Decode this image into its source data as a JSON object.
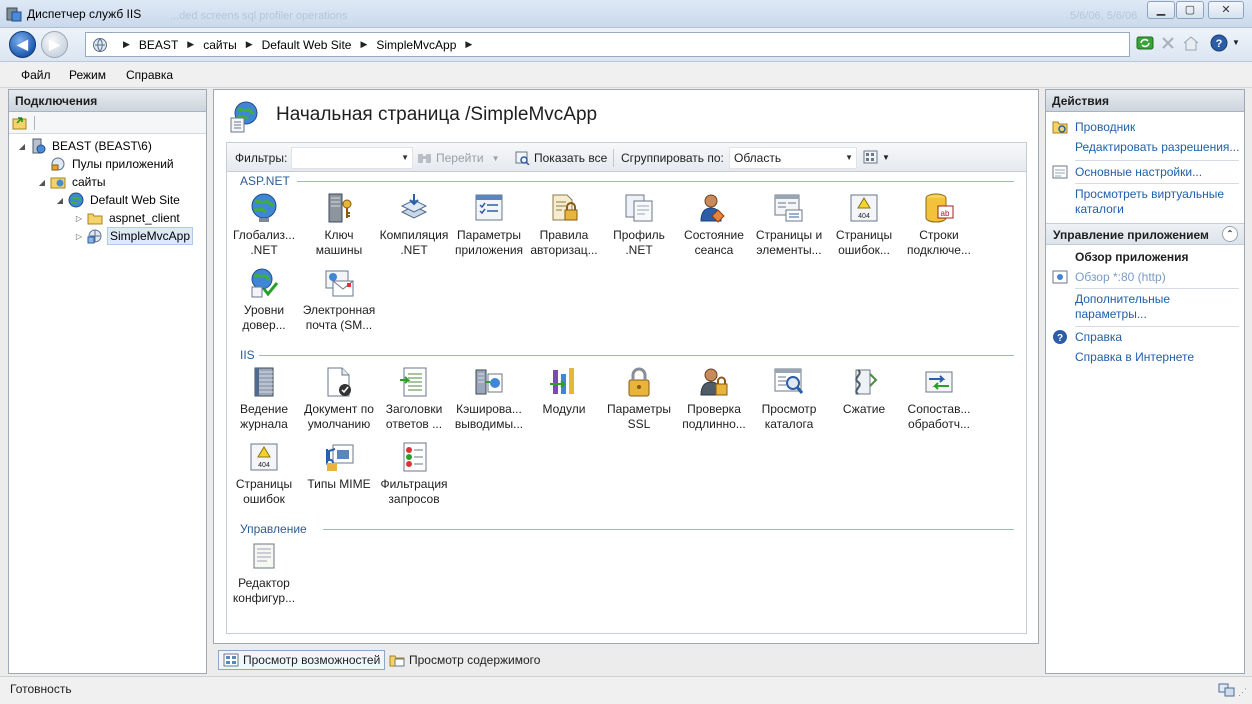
{
  "window": {
    "title": "Диспетчер служб IIS",
    "ghost_title": "...ded screens sql profiler operations",
    "ghost_right": "5/6/06, 5/6/06"
  },
  "address": {
    "crumbs": [
      "BEAST",
      "сайты",
      "Default Web Site",
      "SimpleMvcApp"
    ]
  },
  "menu": [
    "Файл",
    "Режим",
    "Справка"
  ],
  "connections": {
    "header": "Подключения",
    "tree": [
      {
        "label": "BEAST (BEAST\\6)",
        "icon": "server-icon",
        "twisty": "◢"
      },
      {
        "label": "Пулы приложений",
        "icon": "app-pool-icon",
        "twisty": ""
      },
      {
        "label": "сайты",
        "icon": "sites-folder-icon",
        "twisty": "◢"
      },
      {
        "label": "Default Web Site",
        "icon": "globe-icon",
        "twisty": "◢"
      },
      {
        "label": "aspnet_client",
        "icon": "folder-icon",
        "twisty": "▷"
      },
      {
        "label": "SimpleMvcApp",
        "icon": "web-app-icon",
        "twisty": "▷"
      }
    ]
  },
  "main": {
    "title": "Начальная страница /SimpleMvcApp",
    "filter_label": "Фильтры:",
    "go_label": "Перейти",
    "show_all_label": "Показать все",
    "group_by_label": "Сгруппировать по:",
    "group_by_value": "Область",
    "groups": [
      {
        "name": "ASP.NET",
        "items": [
          {
            "l1": "Глобализ...",
            "l2": ".NET",
            "icon": "globalization-icon"
          },
          {
            "l1": "Ключ",
            "l2": "машины",
            "icon": "machine-key-icon"
          },
          {
            "l1": "Компиляция",
            "l2": ".NET",
            "icon": "compilation-icon"
          },
          {
            "l1": "Параметры",
            "l2": "приложения",
            "icon": "app-settings-icon"
          },
          {
            "l1": "Правила",
            "l2": "авторизац...",
            "icon": "authorization-rules-icon"
          },
          {
            "l1": "Профиль",
            "l2": ".NET",
            "icon": "profile-icon"
          },
          {
            "l1": "Состояние",
            "l2": "сеанса",
            "icon": "session-state-icon"
          },
          {
            "l1": "Страницы и",
            "l2": "элементы...",
            "icon": "pages-controls-icon"
          },
          {
            "l1": "Страницы",
            "l2": "ошибок...",
            "icon": "error-pages-icon"
          },
          {
            "l1": "Строки",
            "l2": "подключе...",
            "icon": "connection-strings-icon"
          },
          {
            "l1": "Уровни",
            "l2": "довер...",
            "icon": "trust-levels-icon"
          },
          {
            "l1": "Электронная",
            "l2": "почта (SM...",
            "icon": "smtp-email-icon"
          }
        ]
      },
      {
        "name": "IIS",
        "items": [
          {
            "l1": "Ведение",
            "l2": "журнала",
            "icon": "logging-icon"
          },
          {
            "l1": "Документ по",
            "l2": "умолчанию",
            "icon": "default-document-icon"
          },
          {
            "l1": "Заголовки",
            "l2": "ответов ...",
            "icon": "response-headers-icon"
          },
          {
            "l1": "Кэширова...",
            "l2": "выводимы...",
            "icon": "output-caching-icon"
          },
          {
            "l1": "Модули",
            "l2": "",
            "icon": "modules-icon"
          },
          {
            "l1": "Параметры",
            "l2": "SSL",
            "icon": "ssl-lock-icon"
          },
          {
            "l1": "Проверка",
            "l2": "подлинно...",
            "icon": "authentication-icon"
          },
          {
            "l1": "Просмотр",
            "l2": "каталога",
            "icon": "directory-browsing-icon"
          },
          {
            "l1": "Сжатие",
            "l2": "",
            "icon": "compression-icon"
          },
          {
            "l1": "Сопостав...",
            "l2": "обработч...",
            "icon": "handler-mappings-icon"
          },
          {
            "l1": "Страницы",
            "l2": "ошибок",
            "icon": "error-pages-icon"
          },
          {
            "l1": "Типы MIME",
            "l2": "",
            "icon": "mime-types-icon"
          },
          {
            "l1": "Фильтрация",
            "l2": "запросов",
            "icon": "request-filtering-icon"
          }
        ]
      },
      {
        "name": "Управление",
        "items": [
          {
            "l1": "Редактор",
            "l2": "конфигур...",
            "icon": "config-editor-icon"
          }
        ]
      }
    ]
  },
  "view_tabs": {
    "features": "Просмотр возможностей",
    "content": "Просмотр содержимого"
  },
  "actions": {
    "header": "Действия",
    "explore": "Проводник",
    "edit_permissions": "Редактировать разрешения...",
    "basic_settings": "Основные настройки...",
    "view_vdirs_1": "Просмотреть виртуальные",
    "view_vdirs_2": "каталоги",
    "manage_app_header": "Управление приложением",
    "browse_app": "Обзор приложения",
    "browse_port": "Обзор *:80 (http)",
    "advanced_1": "Дополнительные",
    "advanced_2": "параметры...",
    "help": "Справка",
    "online_help": "Справка в Интернете"
  },
  "status": {
    "text": "Готовность"
  }
}
